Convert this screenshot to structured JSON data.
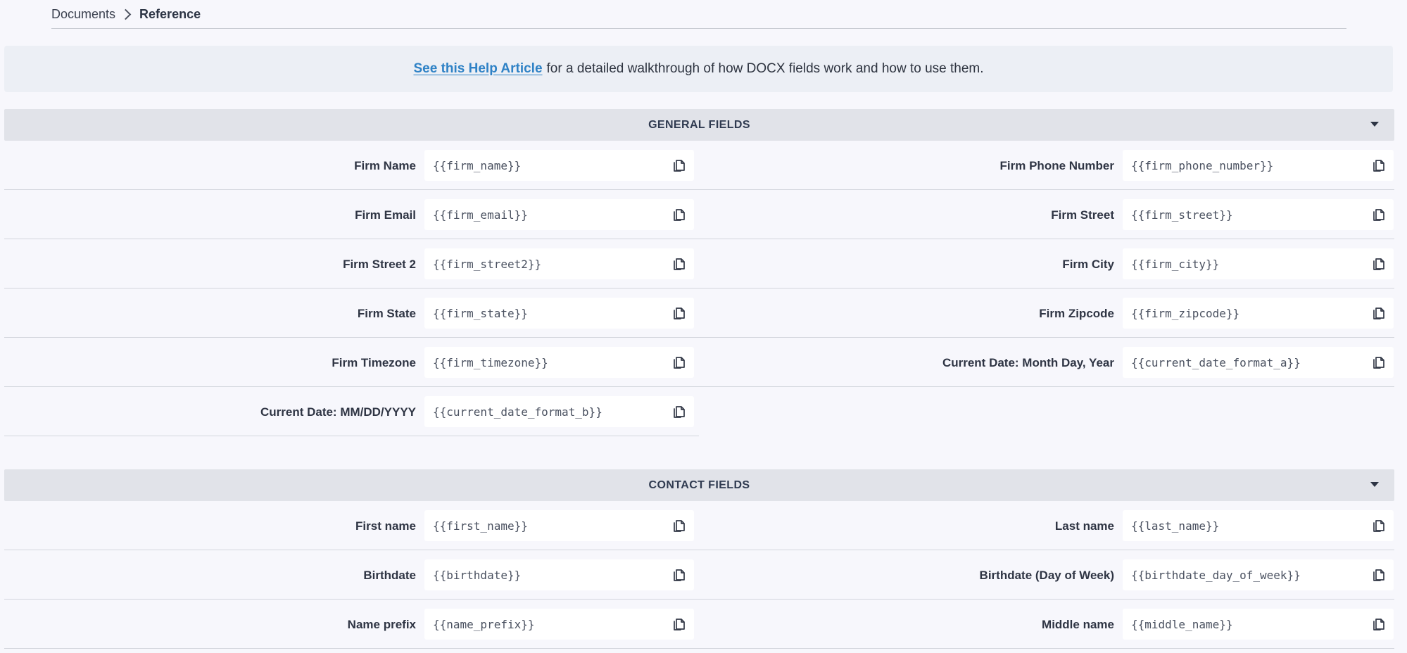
{
  "breadcrumb": {
    "parent": "Documents",
    "current": "Reference"
  },
  "help_banner": {
    "link_text": "See this Help Article",
    "description": "for a detailed walkthrough of how DOCX fields work and how to use them."
  },
  "general_fields": {
    "title": "GENERAL FIELDS",
    "rows": [
      {
        "left": {
          "label": "Firm Name",
          "value": "{{firm_name}}"
        },
        "right": {
          "label": "Firm Phone Number",
          "value": "{{firm_phone_number}}"
        }
      },
      {
        "left": {
          "label": "Firm Email",
          "value": "{{firm_email}}"
        },
        "right": {
          "label": "Firm Street",
          "value": "{{firm_street}}"
        }
      },
      {
        "left": {
          "label": "Firm Street 2",
          "value": "{{firm_street2}}"
        },
        "right": {
          "label": "Firm City",
          "value": "{{firm_city}}"
        }
      },
      {
        "left": {
          "label": "Firm State",
          "value": "{{firm_state}}"
        },
        "right": {
          "label": "Firm Zipcode",
          "value": "{{firm_zipcode}}"
        }
      },
      {
        "left": {
          "label": "Firm Timezone",
          "value": "{{firm_timezone}}"
        },
        "right": {
          "label": "Current Date: Month Day, Year",
          "value": "{{current_date_format_a}}"
        }
      },
      {
        "left": {
          "label": "Current Date: MM/DD/YYYY",
          "value": "{{current_date_format_b}}"
        }
      }
    ]
  },
  "contact_fields": {
    "title": "CONTACT FIELDS",
    "rows": [
      {
        "left": {
          "label": "First name",
          "value": "{{first_name}}"
        },
        "right": {
          "label": "Last name",
          "value": "{{last_name}}"
        }
      },
      {
        "left": {
          "label": "Birthdate",
          "value": "{{birthdate}}"
        },
        "right": {
          "label": "Birthdate (Day of Week)",
          "value": "{{birthdate_day_of_week}}"
        }
      },
      {
        "left": {
          "label": "Name prefix",
          "value": "{{name_prefix}}"
        },
        "right": {
          "label": "Middle name",
          "value": "{{middle_name}}"
        }
      }
    ]
  },
  "colors": {
    "page_background": "#f7f7fc",
    "banner_background": "#eceff5",
    "section_header_background": "#e1e3e9",
    "link": "#2f82c6",
    "text": "#2f3544"
  },
  "icons": {
    "breadcrumb_separator": "chevron-right-icon",
    "section_toggle": "caret-down-icon",
    "copy": "copy-icon"
  }
}
